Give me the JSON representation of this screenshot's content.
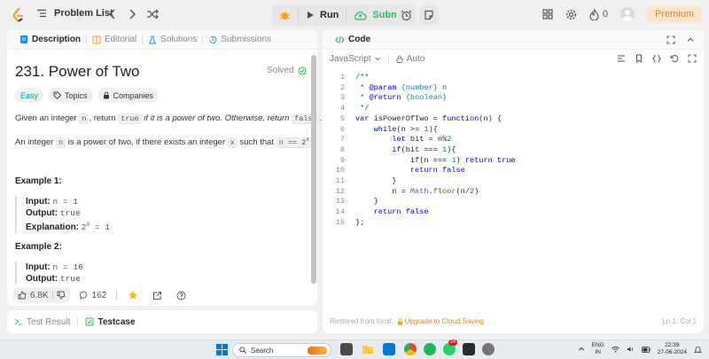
{
  "topbar": {
    "problem_list": "Problem List",
    "run": "Run",
    "submit": "Submit",
    "streak": "0",
    "premium": "Premium"
  },
  "left_tabs": [
    "Description",
    "Editorial",
    "Solutions",
    "Submissions"
  ],
  "problem": {
    "title": "231. Power of Two",
    "status": "Solved",
    "tags": [
      "Easy",
      "Topics",
      "Companies"
    ],
    "desc1_a": "Given an integer ",
    "desc1_code": "n",
    "desc1_b": ", return ",
    "desc1_true": "true",
    "desc1_c": " if it is a power of two. Otherwise, return ",
    "desc1_false": "false",
    "desc1_d": ".",
    "desc2_a": "An integer ",
    "desc2_code": "n",
    "desc2_b": " is a power of two, if there exists an integer ",
    "desc2_x": "x",
    "desc2_c": " such that ",
    "desc2_expr": "n == 2",
    "desc2_sup": "x",
    "desc2_d": ".",
    "example1_title": "Example 1:",
    "example1": {
      "input_label": "Input:",
      "input": "n = 1",
      "output_label": "Output:",
      "output": "true",
      "expl_label": "Explanation:",
      "expl_base": "2",
      "expl_sup": "0",
      "expl_rest": " = 1"
    },
    "example2_title": "Example 2:",
    "example2": {
      "input_label": "Input:",
      "input": "n = 16",
      "output_label": "Output:",
      "output": "true"
    }
  },
  "bottom": {
    "likes": "6.8K",
    "comments": "162"
  },
  "console": {
    "test_result": "Test Result",
    "testcase": "Testcase"
  },
  "editor": {
    "title": "Code",
    "language": "JavaScript",
    "auto": "Auto",
    "footer_left": "Restored from local.",
    "upgrade": "Upgrade to Cloud Saving",
    "cursor": "Ln 1, Col 1"
  },
  "code_lines": [
    "/**",
    " * @param {number} n",
    " * @return {boolean}",
    " */",
    "var isPowerOfTwo = function(n) {",
    "    while(n >= 1){",
    "        let bit = n%2",
    "        if(bit === 1){",
    "            if(n === 1) return true",
    "            return false",
    "        }",
    "        n = Math.floor(n/2)",
    "    }",
    "    return false",
    "};"
  ],
  "taskbar": {
    "search": "Search",
    "badge": "24",
    "lang_top": "ENG",
    "lang_bottom": "IN",
    "time": "22:39",
    "date": "27-06-2024"
  },
  "colors": {
    "accent_orange": "#ffa116",
    "success_green": "#2cbb5d",
    "easy_teal": "#00a8a8",
    "premium_bg": "#fbe6c9"
  }
}
